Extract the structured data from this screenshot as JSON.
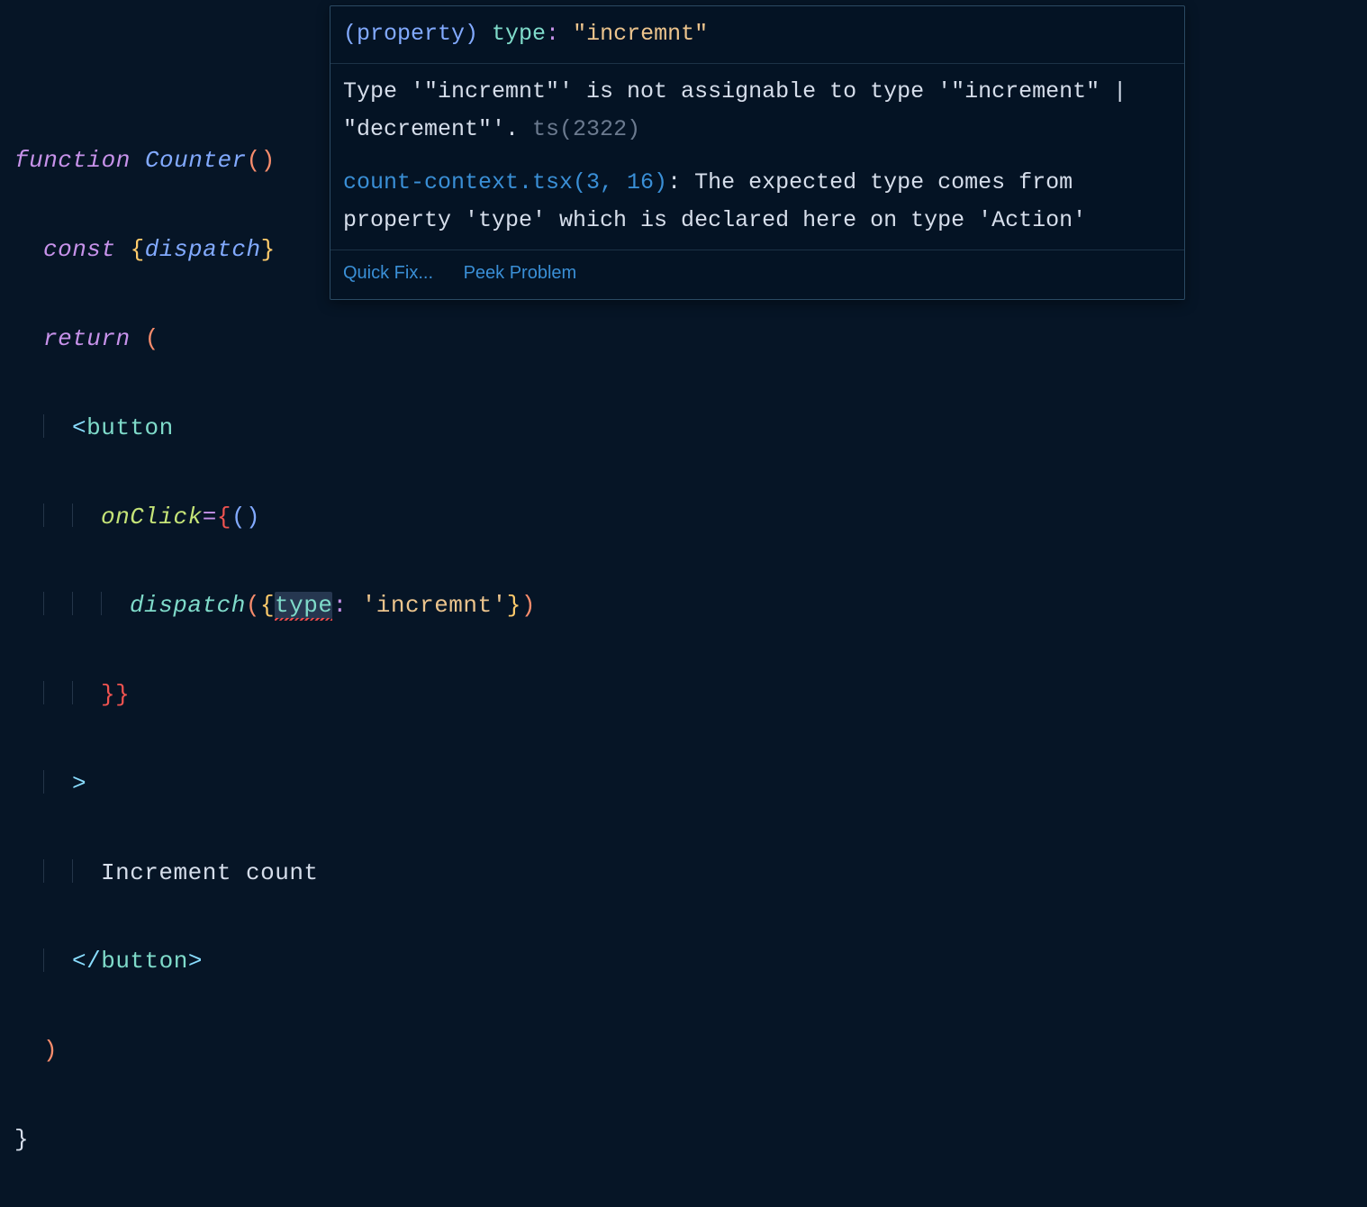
{
  "code": {
    "line1": {
      "function_kw": "function",
      "fn_name": "Counter",
      "open_paren": "(",
      "close_paren": ")"
    },
    "line2": {
      "const_kw": "const",
      "obrace": "{",
      "var": "dispatch",
      "cbrace": "}"
    },
    "line3": {
      "return_kw": "return",
      "paren": "("
    },
    "line4": {
      "lt": "<",
      "tag": "button"
    },
    "line5": {
      "attr": "onClick",
      "eq": "=",
      "obrace": "{",
      "oparen": "(",
      "cparen": ")"
    },
    "line6": {
      "method": "dispatch",
      "oparen": "(",
      "obrace": "{",
      "prop": "type",
      "colon": ":",
      "space": " ",
      "q1": "'",
      "str": "incremnt",
      "q2": "'",
      "cbrace": "}",
      "cparen": ")"
    },
    "line7": {
      "cbrace1": "}",
      "cbrace2": "}"
    },
    "line8": {
      "gt": ">"
    },
    "line9": {
      "text": "Increment count"
    },
    "line10": {
      "lt": "</",
      "tag": "button",
      "gt": ">"
    },
    "line11": {
      "paren": ")"
    },
    "line12": {
      "brace": "}"
    }
  },
  "hover": {
    "signature": {
      "label": "(property) ",
      "prop": "type",
      "op": ": ",
      "q1": "\"",
      "value": "incremnt",
      "q2": "\""
    },
    "error_prefix": "Type '\"incremnt\"' is not assignable to type '\"increment\" | \"decrement\"'.",
    "error_code": " ts(2322)",
    "related": {
      "file": "count-context.tsx",
      "position": "(3, 16)",
      "colon": ": ",
      "msg": "The expected type comes from property 'type' which is declared here on type 'Action'"
    },
    "actions": {
      "quick_fix": "Quick Fix...",
      "peek": "Peek Problem"
    }
  }
}
